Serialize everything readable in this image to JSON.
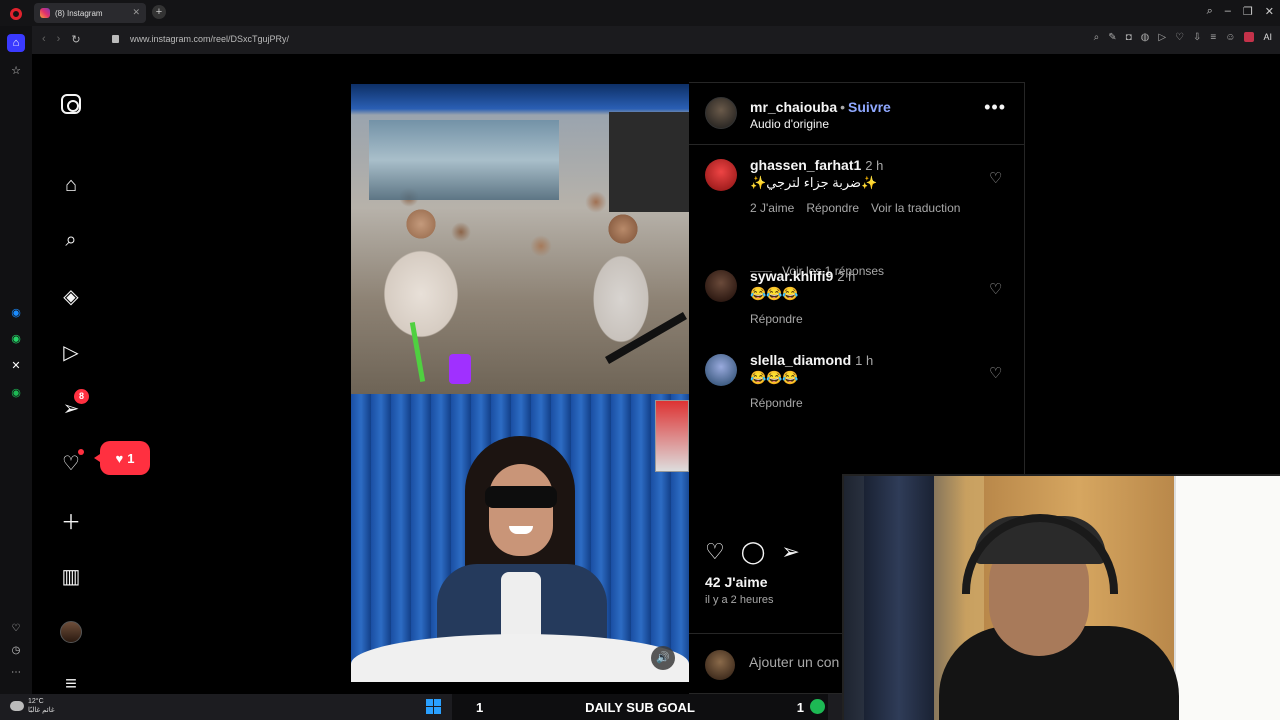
{
  "browser": {
    "tab_title": "(8) Instagram",
    "url": "www.instagram.com/reel/DSxcTgujPRy/",
    "ai_label": "AI"
  },
  "nav": {
    "messages_badge": "8",
    "notification_count": "1"
  },
  "post": {
    "username": "mr_chaiouba",
    "separator": "•",
    "follow_label": "Suivre",
    "audio": "Audio d'origine",
    "more_label": "•••"
  },
  "comments": [
    {
      "username": "ghassen_farhat1",
      "time": "2 h",
      "text": "✨ضربة جزاء لترجي✨",
      "likes": "2 J'aime",
      "reply": "Répondre",
      "translate": "Voir la traduction"
    },
    {
      "username": "sywar.khlifi9",
      "time": "2 h",
      "text": "😂😂😂",
      "reply": "Répondre"
    },
    {
      "username": "slella_diamond",
      "time": "1 h",
      "text": "😂😂😂",
      "reply": "Répondre"
    }
  ],
  "view_replies": "Voir les 1 réponses",
  "likes_count": "42 J'aime",
  "posted_ago": "il y a 2 heures",
  "add_comment_placeholder": "Ajouter un con",
  "taskbar": {
    "temperature": "12°C",
    "weather_text": "غائم غالبًا",
    "subgoal_left": "1",
    "subgoal_label": "DAILY SUB GOAL",
    "subgoal_right": "1"
  },
  "colors": {
    "follow_link": "#8fa8ff",
    "notification_red": "#ff3040",
    "accent_blue": "#0095f6"
  }
}
